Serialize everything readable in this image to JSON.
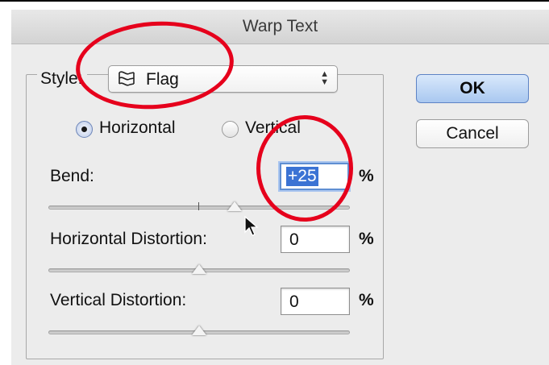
{
  "window": {
    "title": "Warp Text"
  },
  "style": {
    "label": "Style:",
    "value": "Flag",
    "icon": "flag-warp-icon"
  },
  "orientation": {
    "options": [
      {
        "label": "Horizontal",
        "selected": true
      },
      {
        "label": "Vertical",
        "selected": false
      }
    ]
  },
  "bend": {
    "label": "Bend:",
    "value": "+25",
    "unit": "%",
    "slider_level": 0.625
  },
  "horizontal_distortion": {
    "label": "Horizontal Distortion:",
    "value": "0",
    "unit": "%",
    "slider_level": 0.5
  },
  "vertical_distortion": {
    "label": "Vertical Distortion:",
    "value": "0",
    "unit": "%",
    "slider_level": 0.5
  },
  "buttons": {
    "ok": "OK",
    "cancel": "Cancel"
  },
  "colors": {
    "annotation": "#e6001c",
    "default_button": "#a9c8f0",
    "focus_ring": "#5f8fd2",
    "dialog_background": "#ececec"
  }
}
